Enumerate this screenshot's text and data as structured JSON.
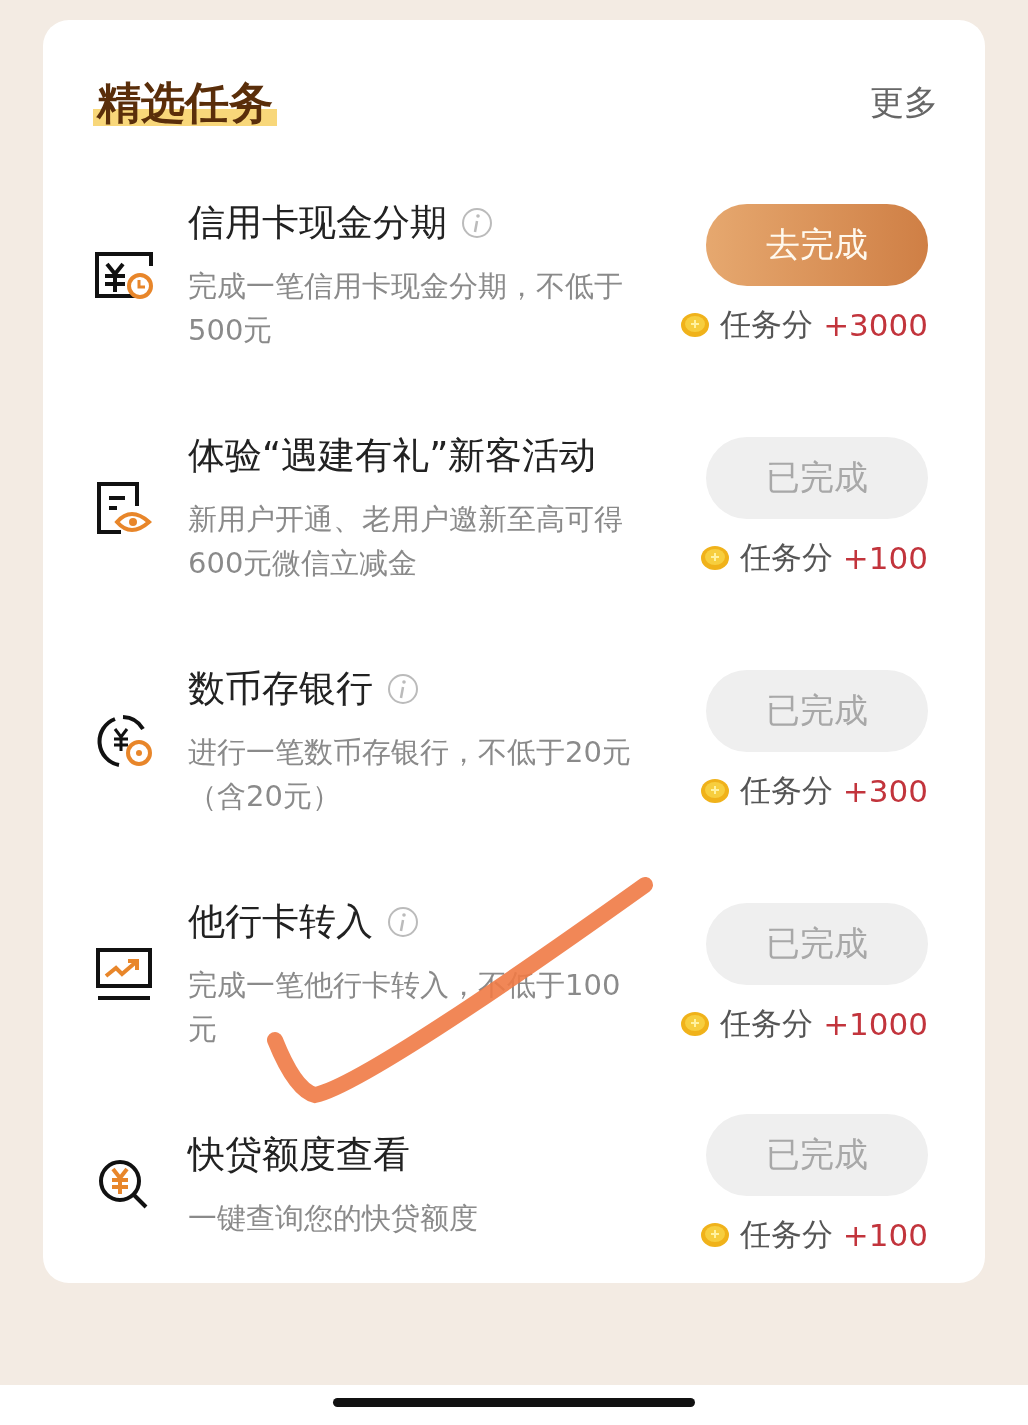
{
  "header": {
    "title": "精选任务",
    "more": "更多"
  },
  "tasks": [
    {
      "title": "信用卡现金分期",
      "info": true,
      "description": "完成一笔信用卡现金分期，不低于500元",
      "button": "去完成",
      "done": false,
      "points_label": "任务分",
      "points": "+3000"
    },
    {
      "title": "体验“遇建有礼”新客活动",
      "info": false,
      "description": "新用户开通、老用户邀新至高可得600元微信立减金",
      "button": "已完成",
      "done": true,
      "points_label": "任务分",
      "points": "+100"
    },
    {
      "title": "数币存银行",
      "info": true,
      "description": "进行一笔数币存银行，不低于20元（含20元）",
      "button": "已完成",
      "done": true,
      "points_label": "任务分",
      "points": "+300"
    },
    {
      "title": "他行卡转入",
      "info": true,
      "description": "完成一笔他行卡转入，不低于100元",
      "button": "已完成",
      "done": true,
      "points_label": "任务分",
      "points": "+1000"
    },
    {
      "title": "快贷额度查看",
      "info": false,
      "description": "一键查询您的快贷额度",
      "button": "已完成",
      "done": true,
      "points_label": "任务分",
      "points": "+100"
    }
  ]
}
